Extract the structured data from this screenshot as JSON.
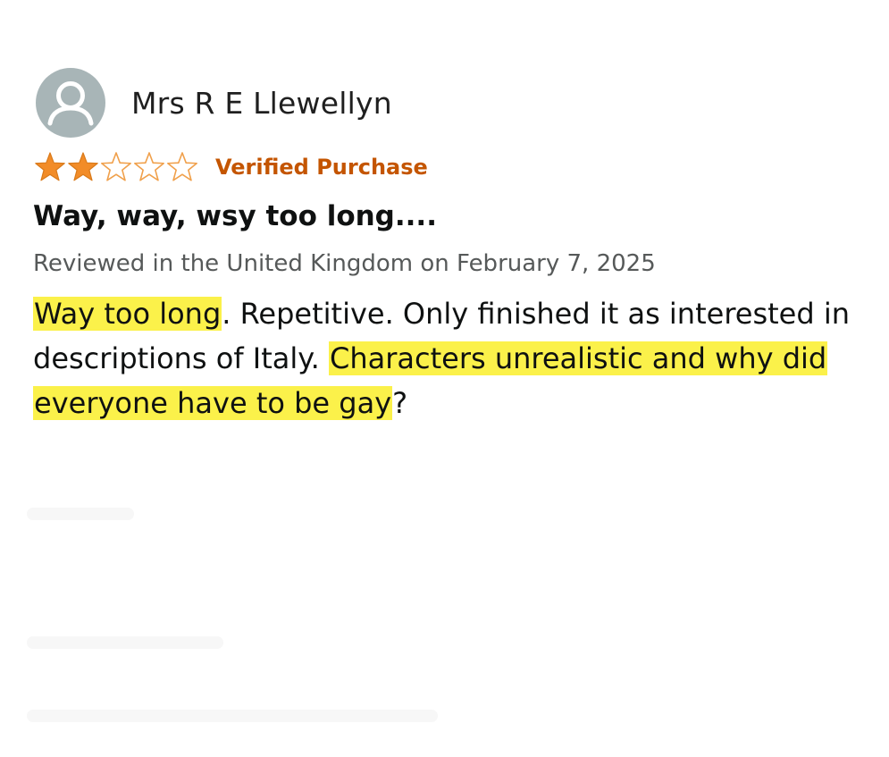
{
  "reviewer": {
    "name": "Mrs R E Llewellyn",
    "avatar_icon": "person-silhouette-icon"
  },
  "rating": {
    "value": 2,
    "max": 5,
    "filled_color": "#f28c28",
    "empty_stroke_color": "#f0a04b"
  },
  "badge": {
    "label": "Verified Purchase",
    "color": "#c45500"
  },
  "review": {
    "title": "Way, way, wsy too long....",
    "meta": "Reviewed in the United Kingdom on February 7, 2025",
    "body": {
      "part1_highlight": "Way too long",
      "part2": ". Repetitive. Only finished it as interested in descriptions of Italy. ",
      "part3_highlight": "Characters unrealistic and why did everyone have to be gay",
      "part4": "?"
    },
    "highlight_color": "#fbf14a"
  }
}
